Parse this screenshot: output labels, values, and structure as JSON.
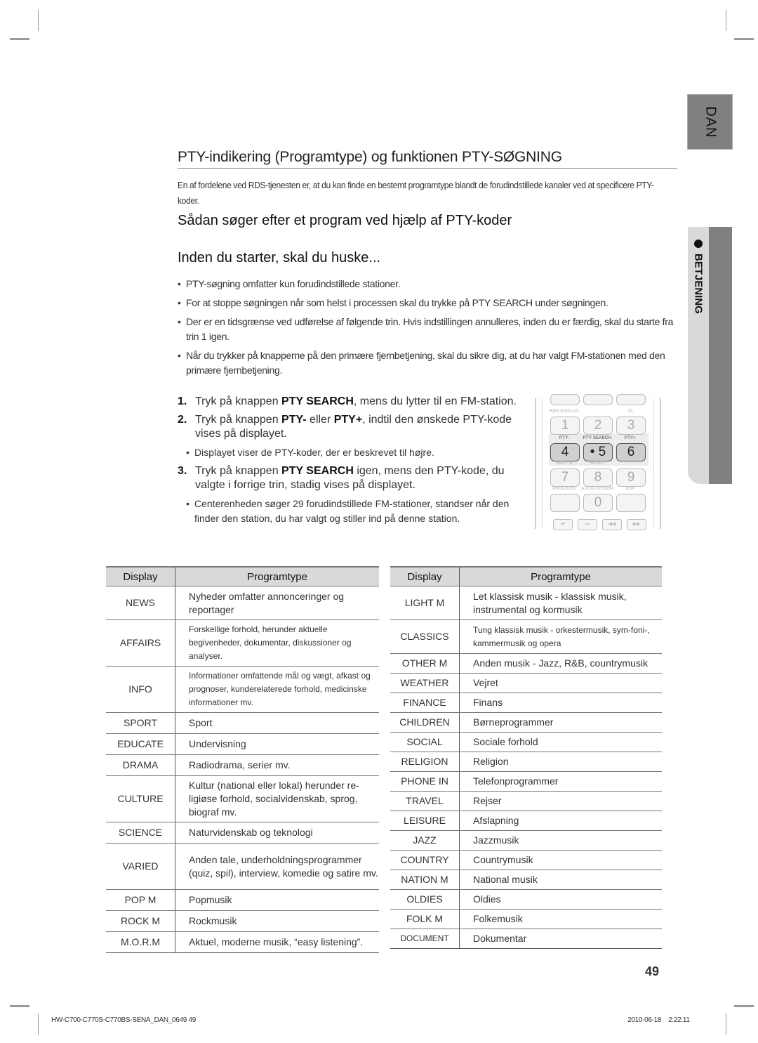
{
  "side_tab": {
    "language": "DAN",
    "section": "BETJENING"
  },
  "title": "PTY-indikering (Programtype) og funktionen PTY-SØGNING",
  "intro": "En af fordelene ved RDS-tjenesten er, at du kan finde en bestemt programtype blandt de forudindstillede kanaler ved at specificere PTY-koder.",
  "heading_search": "Sådan søger efter et program ved hjælp af PTY-koder",
  "heading_before": "Inden du starter, skal du huske...",
  "bullets": [
    "PTY-søgning omfatter kun forudindstillede stationer.",
    "For at stoppe søgningen når som helst i processen skal du trykke på PTY SEARCH under søgningen.",
    "Der er en tidsgrænse ved udførelse af følgende trin. Hvis indstillingen annulleres, inden du er færdig, skal du starte fra trin 1 igen.",
    "Når du trykker på knapperne på den primære fjernbetjening, skal du sikre dig, at du har valgt FM-stationen med den primære fjernbetjening."
  ],
  "steps": [
    {
      "num": "1.",
      "pre": "Tryk på knappen ",
      "bold1": "PTY SEARCH",
      "mid": ", mens du lytter til en FM-station.",
      "bold2": "",
      "post": "",
      "sub": ""
    },
    {
      "num": "2.",
      "pre": "Tryk på knappen ",
      "bold1": "PTY-",
      "mid": " eller ",
      "bold2": "PTY+",
      "post": ", indtil den ønskede PTY-kode vises på displayet.",
      "sub": "Displayet viser de PTY-koder, der er beskrevet til højre."
    },
    {
      "num": "3.",
      "pre": "Tryk på knappen ",
      "bold1": "PTY SEARCH",
      "mid": " igen, mens den PTY-kode, du valgte i forrige trin, stadig vises på displayet.",
      "bold2": "",
      "post": "",
      "sub": "Centerenheden søger 29 forudindstillede FM-stationer, standser når den finder den station, du har valgt og stiller ind på denne station."
    }
  ],
  "remote": {
    "labels": [
      "RDS DISPLAY",
      "",
      "TA",
      "PTY-",
      "PTY SEARCH",
      "PTY+",
      "NEO : 6",
      "SLEEP",
      "",
      "PROLOGIC",
      "AUDIO ASSIGN",
      "DSP"
    ],
    "keys": [
      "1",
      "2",
      "3",
      "4",
      "• 5",
      "6",
      "7",
      "8",
      "9",
      "",
      "0",
      ""
    ],
    "transport": [
      "⏮",
      "⏭",
      "◀◀",
      "▶▶"
    ]
  },
  "table_headers": {
    "display": "Display",
    "programtype": "Programtype"
  },
  "table_left": [
    {
      "display": "NEWS",
      "type": "Nyheder omfatter annonceringer og reportager"
    },
    {
      "display": "AFFAIRS",
      "type": "Forskellige forhold, herunder aktuelle begivenheder, dokumentar, diskussioner og analyser."
    },
    {
      "display": "INFO",
      "type": "Informationer omfattende mål og vægt, afkast og prognoser, kunderelaterede forhold, medicinske informationer mv."
    },
    {
      "display": "SPORT",
      "type": "Sport"
    },
    {
      "display": "EDUCATE",
      "type": "Undervisning"
    },
    {
      "display": "DRAMA",
      "type": "Radiodrama, serier mv."
    },
    {
      "display": "CULTURE",
      "type": "Kultur (national eller lokal) herunder re-ligiøse forhold, socialvidenskab, sprog, biograf mv."
    },
    {
      "display": "SCIENCE",
      "type": "Naturvidenskab og teknologi"
    },
    {
      "display": "VARIED",
      "type": "Anden tale, underholdningsprogrammer (quiz, spil), interview, komedie og satire mv."
    },
    {
      "display": "POP M",
      "type": "Popmusik"
    },
    {
      "display": "ROCK M",
      "type": "Rockmusik"
    },
    {
      "display": "M.O.R.M",
      "type": "Aktuel, moderne musik, “easy listening”."
    }
  ],
  "table_right": [
    {
      "display": "LIGHT M",
      "type": "Let klassisk musik - klassisk musik, instrumental og kormusik"
    },
    {
      "display": "CLASSICS",
      "type": "Tung klassisk musik - orkestermusik, sym-foni-, kammermusik og opera"
    },
    {
      "display": "OTHER M",
      "type": "Anden musik - Jazz, R&B, countrymusik"
    },
    {
      "display": "WEATHER",
      "type": "Vejret"
    },
    {
      "display": "FINANCE",
      "type": "Finans"
    },
    {
      "display": "CHILDREN",
      "type": "Børneprogrammer"
    },
    {
      "display": "SOCIAL",
      "type": "Sociale forhold"
    },
    {
      "display": "RELIGION",
      "type": "Religion"
    },
    {
      "display": "PHONE IN",
      "type": "Telefonprogrammer"
    },
    {
      "display": "TRAVEL",
      "type": "Rejser"
    },
    {
      "display": "LEISURE",
      "type": "Afslapning"
    },
    {
      "display": "JAZZ",
      "type": "Jazzmusik"
    },
    {
      "display": "COUNTRY",
      "type": "Countrymusik"
    },
    {
      "display": "NATION M",
      "type": "National musik"
    },
    {
      "display": "OLDIES",
      "type": "Oldies"
    },
    {
      "display": "FOLK M",
      "type": "Folkemusik"
    },
    {
      "display": "DOCUMENT",
      "type": "Dokumentar"
    }
  ],
  "page_number": "49",
  "footer": {
    "file": "HW-C700-C770S-C770BS-SENA_DAN_0649   49",
    "date": "2010-06-18",
    "time": "2:22:11"
  }
}
